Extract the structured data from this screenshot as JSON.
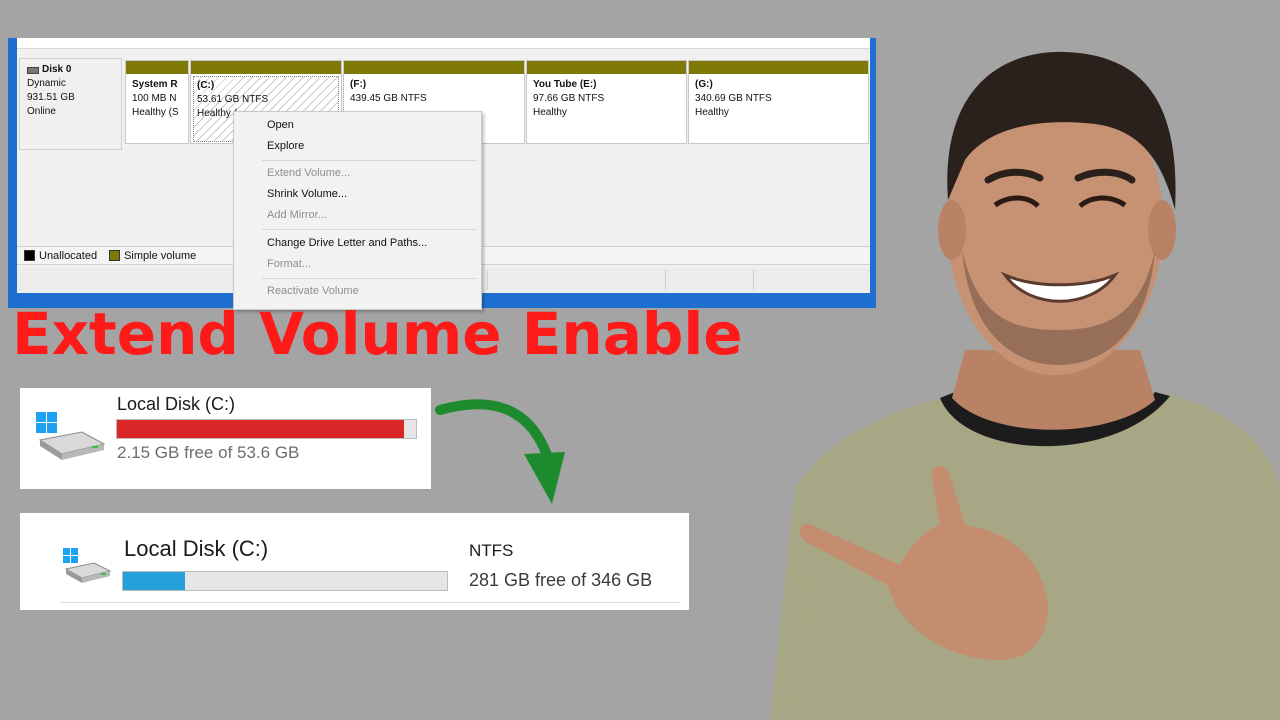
{
  "disk_management": {
    "disk": {
      "name": "Disk 0",
      "type": "Dynamic",
      "size": "931.51 GB",
      "status": "Online"
    },
    "partitions": [
      {
        "name": "System R",
        "size": "100 MB N",
        "status": "Healthy (S"
      },
      {
        "name": "(C:)",
        "size": "53.61 GB NTFS",
        "status": "Healthy ("
      },
      {
        "name": "(F:)",
        "size": "439.45 GB NTFS",
        "status": ""
      },
      {
        "name": "You Tube  (E:)",
        "size": "97.66 GB NTFS",
        "status": "Healthy"
      },
      {
        "name": "(G:)",
        "size": "340.69 GB NTFS",
        "status": "Healthy"
      }
    ],
    "legend": [
      {
        "label": "Unallocated",
        "color": "#000000"
      },
      {
        "label": "Simple volume",
        "color": "#7f7a08"
      }
    ]
  },
  "context_menu": {
    "items": [
      {
        "label": "Open",
        "enabled": true
      },
      {
        "label": "Explore",
        "enabled": true
      },
      {
        "label": "Extend Volume...",
        "enabled": false
      },
      {
        "label": "Shrink Volume...",
        "enabled": true
      },
      {
        "label": "Add Mirror...",
        "enabled": false
      },
      {
        "label": "Change Drive Letter and Paths...",
        "enabled": true
      },
      {
        "label": "Format...",
        "enabled": false
      },
      {
        "label": "Reactivate Volume",
        "enabled": false
      }
    ]
  },
  "headline": {
    "text": "Extend Volume Enable",
    "color": "#ff1a1a"
  },
  "drive_before": {
    "title": "Local Disk (C:)",
    "free_text": "2.15 GB free of 53.6 GB",
    "used_fraction": 0.96,
    "bar_color": "#da2626"
  },
  "drive_after": {
    "title": "Local Disk (C:)",
    "filesystem": "NTFS",
    "free_text": "281 GB free of 346 GB",
    "used_fraction": 0.19,
    "bar_color": "#26a0da"
  },
  "arrow": {
    "color": "#1e8a2e"
  },
  "colors": {
    "background": "#a4a4a4",
    "window_border": "#1e6fd0"
  }
}
